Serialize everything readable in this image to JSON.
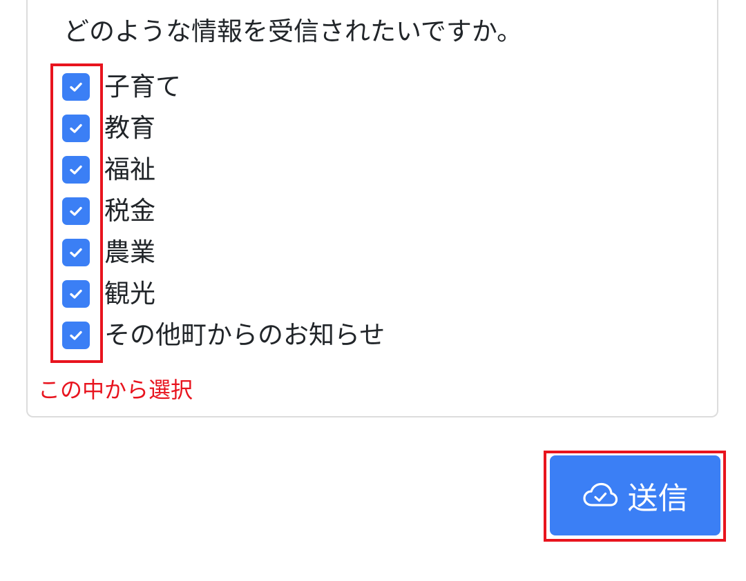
{
  "form": {
    "question": "どのような情報を受信されたいですか。",
    "options": [
      {
        "label": "子育て",
        "checked": true
      },
      {
        "label": "教育",
        "checked": true
      },
      {
        "label": "福祉",
        "checked": true
      },
      {
        "label": "税金",
        "checked": true
      },
      {
        "label": "農業",
        "checked": true
      },
      {
        "label": "観光",
        "checked": true
      },
      {
        "label": "その他町からのお知らせ",
        "checked": true
      }
    ],
    "hint": "この中から選択"
  },
  "submit": {
    "label": "送信",
    "icon": "cloud-check-icon"
  },
  "colors": {
    "accent": "#3b7ff5",
    "highlight": "#e8141e",
    "card_border": "#dcdcdc",
    "text": "#212529"
  }
}
